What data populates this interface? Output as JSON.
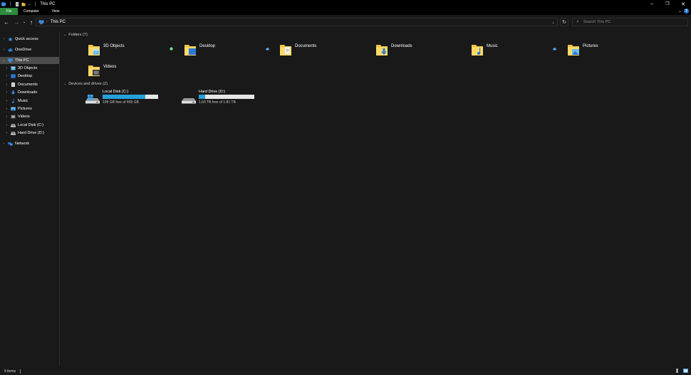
{
  "window": {
    "title": "This PC"
  },
  "ribbon": {
    "tabs": [
      "File",
      "Computer",
      "View"
    ]
  },
  "address": {
    "breadcrumb": "This PC"
  },
  "search": {
    "placeholder": "Search This PC"
  },
  "nav": {
    "items": [
      {
        "label": "Quick access",
        "icon": "star-icon",
        "level": 0
      },
      {
        "label": "OneDrive",
        "icon": "cloud-icon",
        "level": 0
      },
      {
        "label": "This PC",
        "icon": "computer-icon",
        "level": 0,
        "selected": true,
        "expanded": true
      },
      {
        "label": "3D Objects",
        "icon": "cube-icon",
        "level": 1
      },
      {
        "label": "Desktop",
        "icon": "desktop-icon",
        "level": 1
      },
      {
        "label": "Documents",
        "icon": "document-icon",
        "level": 1
      },
      {
        "label": "Downloads",
        "icon": "download-icon",
        "level": 1
      },
      {
        "label": "Music",
        "icon": "music-icon",
        "level": 1
      },
      {
        "label": "Pictures",
        "icon": "picture-icon",
        "level": 1
      },
      {
        "label": "Videos",
        "icon": "video-icon",
        "level": 1
      },
      {
        "label": "Local Disk (C:)",
        "icon": "drive-icon",
        "level": 1
      },
      {
        "label": "Hard Drive (D:)",
        "icon": "drive-icon",
        "level": 1
      },
      {
        "label": "Network",
        "icon": "network-icon",
        "level": 0
      }
    ]
  },
  "folders": {
    "header": "Folders (7)",
    "items": [
      {
        "name": "3D Objects",
        "status": "synced"
      },
      {
        "name": "Desktop",
        "status": "cloud"
      },
      {
        "name": "Documents",
        "status": ""
      },
      {
        "name": "Downloads",
        "status": ""
      },
      {
        "name": "Music",
        "status": "cloud"
      },
      {
        "name": "Pictures",
        "status": ""
      },
      {
        "name": "Videos",
        "status": ""
      }
    ]
  },
  "drives": {
    "header": "Devices and drives (2)",
    "items": [
      {
        "name": "Local Disk (C:)",
        "free_text": "109 GB free of 465 GB",
        "used_fraction": 0.77
      },
      {
        "name": "Hard Drive (D:)",
        "free_text": "1.60 TB free of 1.81 TB",
        "used_fraction": 0.12
      }
    ]
  },
  "statusbar": {
    "item_count": "9 items"
  },
  "colors": {
    "background": "#191919",
    "file_tab": "#2b8c3c",
    "drive_bar_fill": "#26a0da",
    "folder_yellow": "#f3c442",
    "selected_nav": "#4d4d4d"
  }
}
